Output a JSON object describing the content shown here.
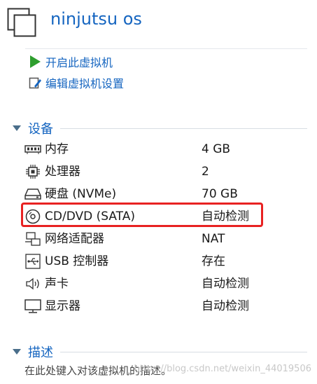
{
  "vm": {
    "title": "ninjutsu os"
  },
  "actions": [
    {
      "label": "开启此虚拟机",
      "icon": "play-icon"
    },
    {
      "label": "编辑虚拟机设置",
      "icon": "edit-settings-icon"
    }
  ],
  "devices_section": {
    "label": "设备"
  },
  "devices": [
    {
      "name": "内存",
      "value": "4 GB",
      "icon": "memory-icon"
    },
    {
      "name": "处理器",
      "value": "2",
      "icon": "processor-icon"
    },
    {
      "name": "硬盘 (NVMe)",
      "value": "70 GB",
      "icon": "hard-disk-icon"
    },
    {
      "name": "CD/DVD (SATA)",
      "value": "自动检测",
      "icon": "cd-dvd-icon"
    },
    {
      "name": "网络适配器",
      "value": "NAT",
      "icon": "network-adapter-icon"
    },
    {
      "name": "USB 控制器",
      "value": "存在",
      "icon": "usb-icon"
    },
    {
      "name": "声卡",
      "value": "自动检测",
      "icon": "speaker-icon"
    },
    {
      "name": "显示器",
      "value": "自动检测",
      "icon": "monitor-icon"
    }
  ],
  "description_section": {
    "label": "描述",
    "placeholder": "在此处键入对该虚拟机的描述。"
  },
  "watermark": "https://blog.csdn.net/weixin_44019506",
  "colors": {
    "accent": "#1565c0",
    "highlight": "#e82222",
    "play": "#2e9e2e"
  }
}
